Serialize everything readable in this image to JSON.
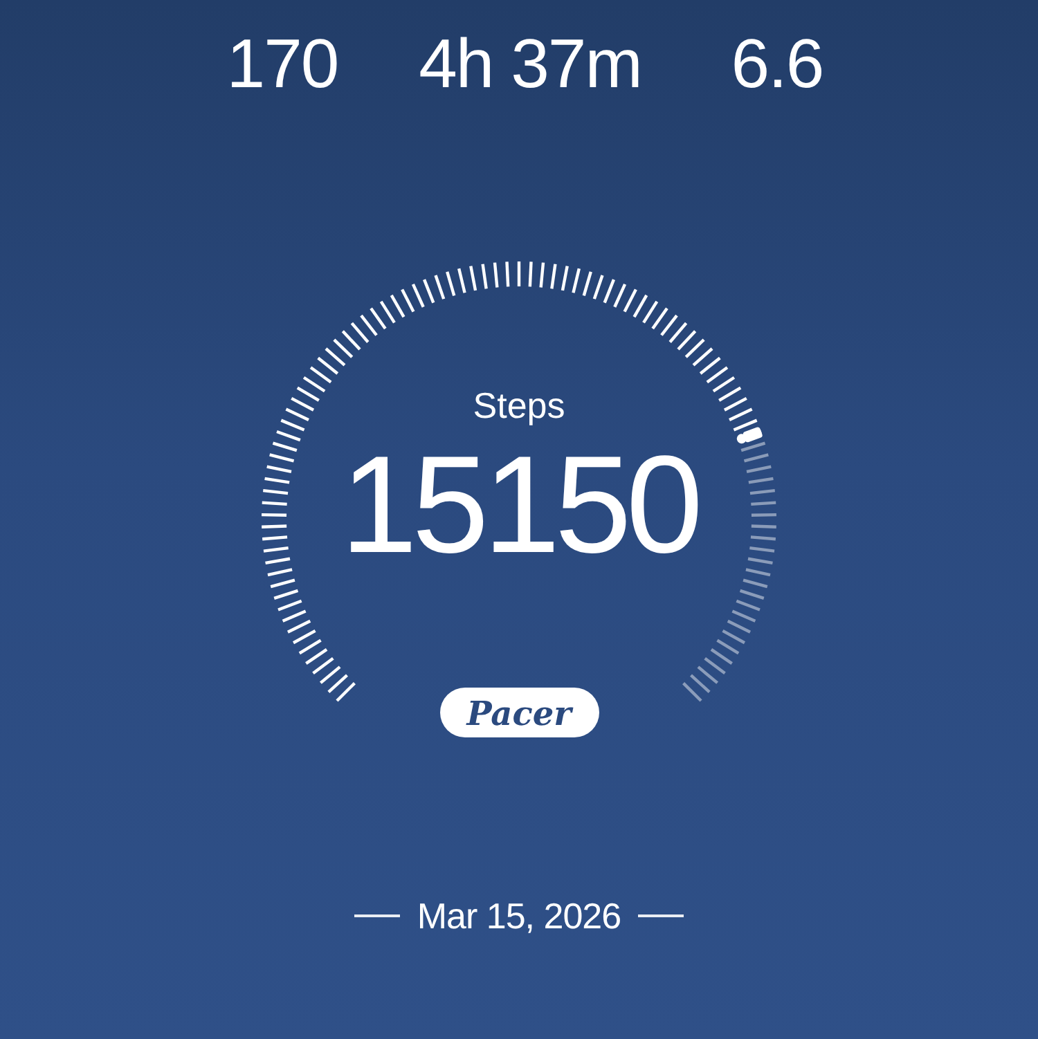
{
  "stats": [
    {
      "value": "170"
    },
    {
      "value": "4h 37m"
    },
    {
      "value": "6.6"
    }
  ],
  "gauge": {
    "label": "Steps",
    "value": "15150"
  },
  "logo": "Pacer",
  "date": "Mar 15, 2026"
}
